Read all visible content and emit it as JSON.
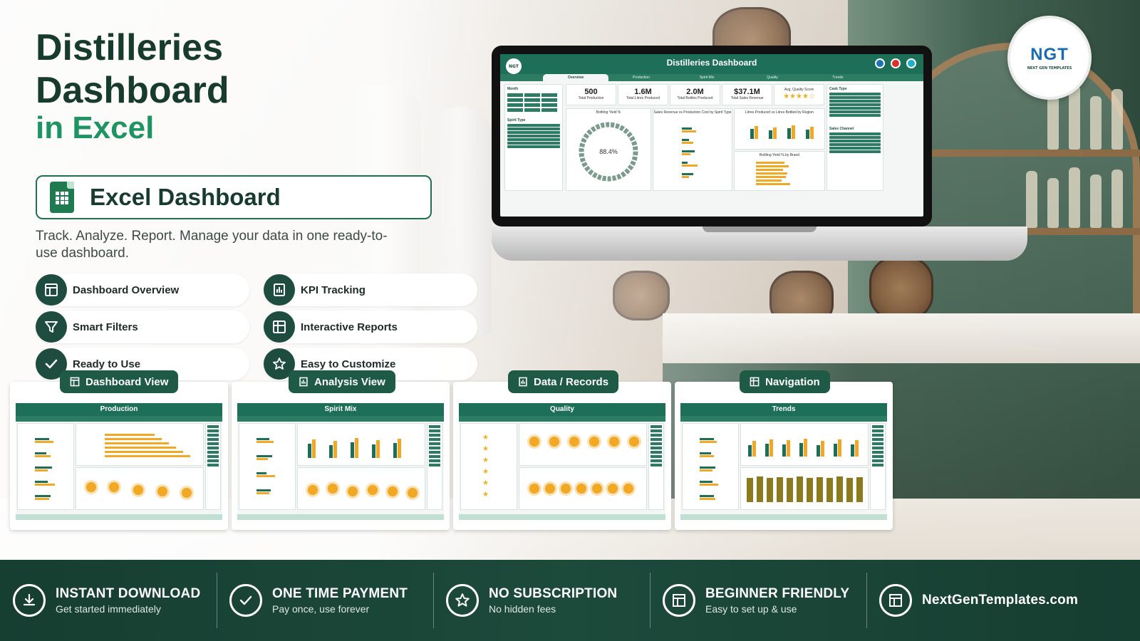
{
  "hero": {
    "title_line1": "Distilleries",
    "title_line2": "Dashboard",
    "title_line3": "in Excel",
    "pill_label": "Excel Dashboard",
    "tagline": "Track. Analyze. Report. Manage your data in one ready-to-use dashboard."
  },
  "features": [
    {
      "label": "Dashboard Overview",
      "icon": "layout-icon"
    },
    {
      "label": "KPI Tracking",
      "icon": "kpi-icon"
    },
    {
      "label": "Smart Filters",
      "icon": "filter-icon"
    },
    {
      "label": "Interactive Reports",
      "icon": "report-icon"
    },
    {
      "label": "Ready to Use",
      "icon": "check-icon"
    },
    {
      "label": "Easy to Customize",
      "icon": "star-icon"
    }
  ],
  "laptop_dashboard": {
    "title": "Distilleries Dashboard",
    "logo": "NGT",
    "tabs": [
      "Overview",
      "Production",
      "Spirit Mix",
      "Quality",
      "Trends"
    ],
    "active_tab": "Overview",
    "kpis": [
      {
        "value": "500",
        "label": "Total Production"
      },
      {
        "value": "1.6M",
        "label": "Total Litres Produced"
      },
      {
        "value": "2.0M",
        "label": "Total Bottles Produced"
      },
      {
        "value": "$37.1M",
        "label": "Total Sales Revenue"
      }
    ],
    "quality_label": "Avg. Quality Score",
    "slicers": {
      "month": "Month",
      "spirit_type": "Spirit Type",
      "cask_type": "Cask Type",
      "sales_channel": "Sales Channel"
    },
    "panels": {
      "bottling_yield": "Bottling Yield %",
      "bottling_yield_value": "88.4%",
      "sales_vs_cost": "Sales Revenue vs Production Cost by Spirit Type",
      "litres_vs_bottled": "Litres Produced vs Litres Bottled by Region",
      "yield_by_brand": "Bottling Yield % by Brand"
    }
  },
  "logo": {
    "mark": "NGT",
    "subtitle": "NEXT GEN TEMPLATES"
  },
  "previews": [
    {
      "badge": "Dashboard View",
      "title": "Production",
      "badge_icon": "layout-icon"
    },
    {
      "badge": "Analysis View",
      "title": "Spirit Mix",
      "badge_icon": "report-icon"
    },
    {
      "badge": "Data / Records",
      "title": "Quality",
      "badge_icon": "report-icon"
    },
    {
      "badge": "Navigation",
      "title": "Trends",
      "badge_icon": "layout-icon"
    }
  ],
  "footer": [
    {
      "head": "INSTANT DOWNLOAD",
      "sub": "Get started immediately",
      "icon": "download-icon"
    },
    {
      "head": "ONE TIME PAYMENT",
      "sub": "Pay once, use forever",
      "icon": "check-icon"
    },
    {
      "head": "NO SUBSCRIPTION",
      "sub": "No hidden fees",
      "icon": "star-icon"
    },
    {
      "head": "BEGINNER FRIENDLY",
      "sub": "Easy to set up & use",
      "icon": "layout-icon"
    },
    {
      "head": "NextGenTemplates.com",
      "sub": "",
      "icon": "layout-icon"
    }
  ],
  "colors": {
    "brand_dark": "#1e4d3f",
    "brand_green": "#1f9463",
    "accent_gold": "#f1a824"
  }
}
